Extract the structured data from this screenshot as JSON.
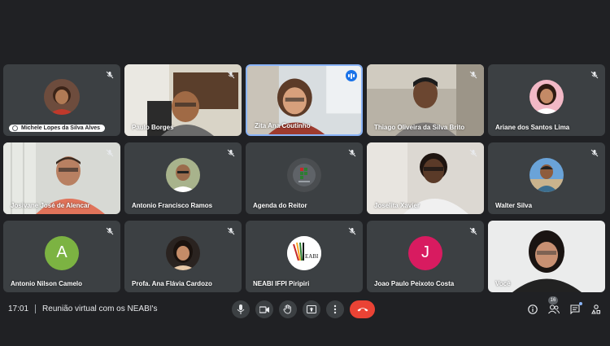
{
  "meeting": {
    "time": "17:01",
    "title": "Reunião virtual com os NEABI's"
  },
  "participants": [
    {
      "name": "Michele Lopes da Silva Alves",
      "type": "avatar-photo",
      "mic": "off",
      "pinned_label": true
    },
    {
      "name": "Paulo Borges",
      "type": "video",
      "mic": "off"
    },
    {
      "name": "Zita Ana Coutinho",
      "type": "video",
      "mic": "speaking",
      "active": true
    },
    {
      "name": "Thiago Oliveira da Silva Brito",
      "type": "video",
      "mic": "off"
    },
    {
      "name": "Ariane dos Santos Lima",
      "type": "avatar-photo",
      "mic": "off"
    },
    {
      "name": "Josivane José de Alencar",
      "type": "video",
      "mic": "off"
    },
    {
      "name": "Antonio Francisco Ramos",
      "type": "avatar-photo",
      "mic": "off"
    },
    {
      "name": "Agenda do Reitor",
      "type": "avatar-logo",
      "mic": "off"
    },
    {
      "name": "Joselita Xavier",
      "type": "video",
      "mic": "off"
    },
    {
      "name": "Walter Silva",
      "type": "avatar-photo",
      "mic": "off"
    },
    {
      "name": "Antonio Nilson Camelo",
      "type": "avatar-letter",
      "letter": "A",
      "color": "#7cb342",
      "mic": "off"
    },
    {
      "name": "Profa. Ana Flávia Cardozo",
      "type": "avatar-photo",
      "mic": "off"
    },
    {
      "name": "NEABI IFPI Piripiri",
      "type": "avatar-logo",
      "logo_text": "NEABI",
      "mic": "off"
    },
    {
      "name": "Joao Paulo Peixoto Costa",
      "type": "avatar-letter",
      "letter": "J",
      "color": "#d81b60",
      "mic": "off"
    },
    {
      "name": "Você",
      "type": "video",
      "mic": "on"
    }
  ],
  "controls": [
    "mic-icon",
    "camera-icon",
    "raise-hand-icon",
    "present-screen-icon",
    "more-options-icon",
    "end-call-icon"
  ],
  "right_controls": {
    "info": "info-icon",
    "people_count": "16",
    "chat": "chat-icon",
    "activities": "activities-icon"
  },
  "colors": {
    "background": "#202124",
    "tile": "#3c4043",
    "active_border": "#8ab4f8",
    "hangup": "#ea4335",
    "speaking": "#1a73e8"
  }
}
